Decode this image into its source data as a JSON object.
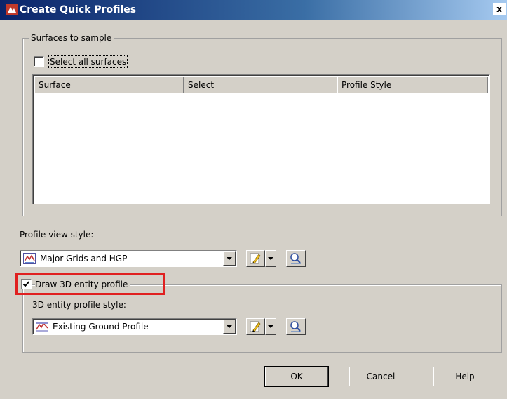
{
  "window": {
    "title": "Create Quick Profiles",
    "close_glyph": "x"
  },
  "surfaces": {
    "group_label": "Surfaces to sample",
    "select_all_label": "Select all surfaces",
    "select_all_checked": false,
    "columns": [
      "Surface",
      "Select",
      "Profile Style"
    ],
    "rows": []
  },
  "profile_view": {
    "label": "Profile view style:",
    "value": "Major Grids and HGP",
    "icon": "profile-view-style-icon"
  },
  "draw3d": {
    "checkbox_label": "Draw 3D entity profile",
    "checked": true,
    "style_label": "3D entity profile style:",
    "value": "Existing Ground Profile",
    "icon": "profile-style-icon"
  },
  "buttons": {
    "ok": "OK",
    "cancel": "Cancel",
    "help": "Help"
  },
  "colors": {
    "highlight": "#e02020",
    "dialog_bg": "#d4d0c8"
  }
}
